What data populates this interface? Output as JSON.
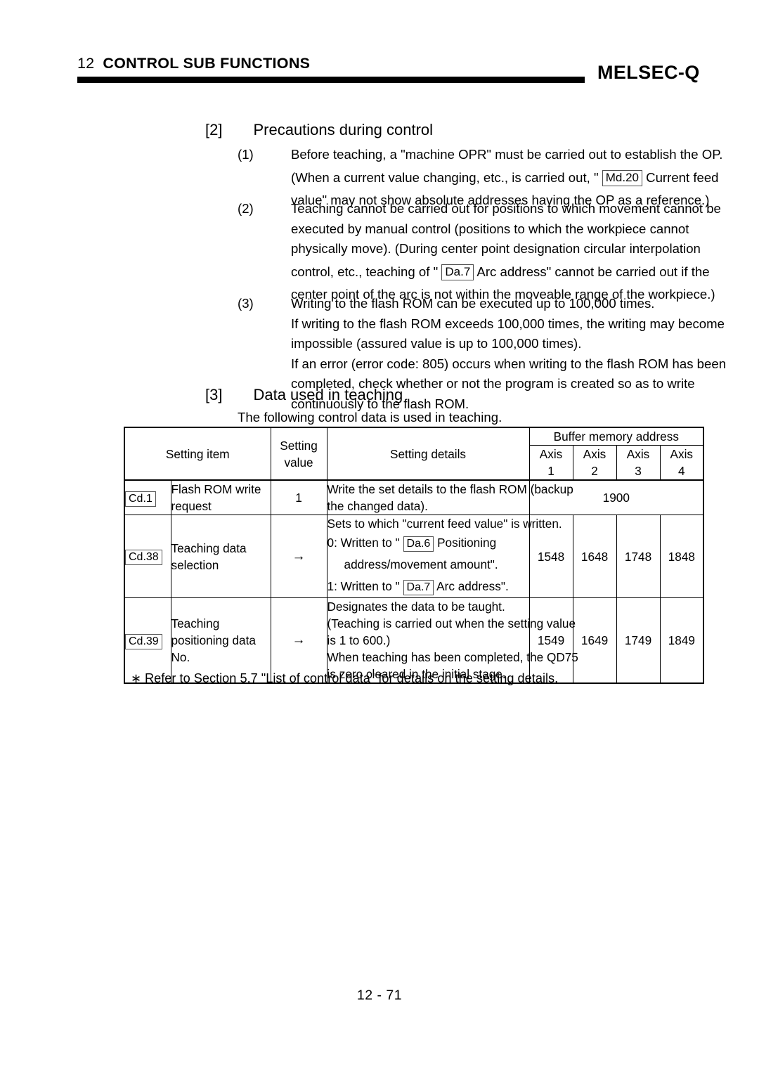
{
  "header": {
    "chapter_number": "12",
    "chapter_title": "CONTROL SUB FUNCTIONS",
    "brand": "MELSEC-Q"
  },
  "sections": [
    {
      "marker": "[2]",
      "title": "Precautions during control",
      "items": [
        {
          "num": "(1)",
          "lines": [
            [
              {
                "t": "text",
                "v": "Before teaching, a \"machine OPR\" must be carried out to establish the OP."
              }
            ],
            [
              {
                "t": "text",
                "v": "(When a current value changing, etc., is carried out, \" "
              },
              {
                "t": "chip",
                "v": "Md.20"
              },
              {
                "t": "text",
                "v": "  Current feed"
              }
            ],
            [
              {
                "t": "text",
                "v": "value\" may not show absolute addresses having the OP as a reference.)"
              }
            ]
          ]
        },
        {
          "num": "(2)",
          "lines": [
            [
              {
                "t": "text",
                "v": "Teaching cannot be carried out for positions to which movement cannot be"
              }
            ],
            [
              {
                "t": "text",
                "v": "executed by manual control (positions to which the workpiece cannot"
              }
            ],
            [
              {
                "t": "text",
                "v": "physically move). (During center point designation circular interpolation"
              }
            ],
            [
              {
                "t": "text",
                "v": "control, etc., teaching of \" "
              },
              {
                "t": "chip",
                "v": "Da.7"
              },
              {
                "t": "text",
                "v": "  Arc address\" cannot be carried out if the"
              }
            ],
            [
              {
                "t": "text",
                "v": "center point of the arc is not within the moveable range of the workpiece.)"
              }
            ]
          ]
        },
        {
          "num": "(3)",
          "lines": [
            [
              {
                "t": "text",
                "v": "Writing to the flash ROM can be executed up to 100,000 times."
              }
            ],
            [
              {
                "t": "text",
                "v": "If writing to the flash ROM exceeds 100,000 times, the writing may become"
              }
            ],
            [
              {
                "t": "text",
                "v": "impossible (assured value is up to 100,000 times)."
              }
            ],
            [
              {
                "t": "text",
                "v": "If an error (error code: 805) occurs when writing to the flash ROM has been"
              }
            ],
            [
              {
                "t": "text",
                "v": "completed, check whether or not the program is created so as to write"
              }
            ],
            [
              {
                "t": "text",
                "v": "continuously to the flash ROM."
              }
            ]
          ]
        }
      ]
    },
    {
      "marker": "[3]",
      "title": "Data used in teaching",
      "intro": "The following control data is used in teaching."
    }
  ],
  "table": {
    "headers": {
      "setting_item": "Setting item",
      "setting_value_l1": "Setting",
      "setting_value_l2": "value",
      "setting_details": "Setting details",
      "buffer_memory_address": "Buffer memory address",
      "axes": [
        {
          "l1": "Axis",
          "l2": "1"
        },
        {
          "l1": "Axis",
          "l2": "2"
        },
        {
          "l1": "Axis",
          "l2": "3"
        },
        {
          "l1": "Axis",
          "l2": "4"
        }
      ]
    },
    "rows": [
      {
        "chip": "Cd.1",
        "item_lines": [
          "Flash ROM write",
          "request"
        ],
        "value": "1",
        "details": [
          {
            "indent": false,
            "tall": false,
            "parts": [
              {
                "t": "text",
                "v": "Write the set details to the flash ROM (backup"
              }
            ]
          },
          {
            "indent": false,
            "tall": false,
            "parts": [
              {
                "t": "text",
                "v": "the changed data)."
              }
            ]
          }
        ],
        "address_span": true,
        "address": "1900",
        "addresses": []
      },
      {
        "chip": "Cd.38",
        "item_lines": [
          "Teaching data",
          "selection"
        ],
        "value": "→",
        "value_is_arrow": true,
        "details": [
          {
            "indent": false,
            "tall": false,
            "parts": [
              {
                "t": "text",
                "v": "Sets to which \"current feed value\" is written."
              }
            ]
          },
          {
            "indent": false,
            "tall": true,
            "parts": [
              {
                "t": "text",
                "v": "0: Written to \" "
              },
              {
                "t": "chip",
                "v": "Da.6"
              },
              {
                "t": "text",
                "v": " Positioning"
              }
            ]
          },
          {
            "indent": true,
            "tall": true,
            "parts": [
              {
                "t": "text",
                "v": "address/movement amount\"."
              }
            ]
          },
          {
            "indent": false,
            "tall": true,
            "parts": [
              {
                "t": "text",
                "v": "1: Written to \" "
              },
              {
                "t": "chip",
                "v": "Da.7"
              },
              {
                "t": "text",
                "v": " Arc address\"."
              }
            ]
          }
        ],
        "address_span": false,
        "address": "",
        "addresses": [
          "1548",
          "1648",
          "1748",
          "1848"
        ]
      },
      {
        "chip": "Cd.39",
        "item_lines": [
          "Teaching",
          "positioning data",
          "No."
        ],
        "value": "→",
        "value_is_arrow": true,
        "details": [
          {
            "indent": false,
            "tall": false,
            "parts": [
              {
                "t": "text",
                "v": "Designates the data to be taught."
              }
            ]
          },
          {
            "indent": false,
            "tall": false,
            "parts": [
              {
                "t": "text",
                "v": "(Teaching is carried out when the setting value"
              }
            ]
          },
          {
            "indent": false,
            "tall": false,
            "parts": [
              {
                "t": "text",
                "v": "is 1 to 600.)"
              }
            ]
          },
          {
            "indent": false,
            "tall": false,
            "parts": [
              {
                "t": "text",
                "v": "When teaching has been completed, the QD75"
              }
            ]
          },
          {
            "indent": false,
            "tall": false,
            "parts": [
              {
                "t": "text",
                "v": "is zero cleared in the initial stage."
              }
            ]
          }
        ],
        "address_span": false,
        "address": "",
        "addresses": [
          "1549",
          "1649",
          "1749",
          "1849"
        ]
      }
    ]
  },
  "footnote": {
    "symbol": "∗",
    "text": "Refer to Section 5.7 \"List of control data\" for details on the setting details."
  },
  "page_number": "12 - 71"
}
